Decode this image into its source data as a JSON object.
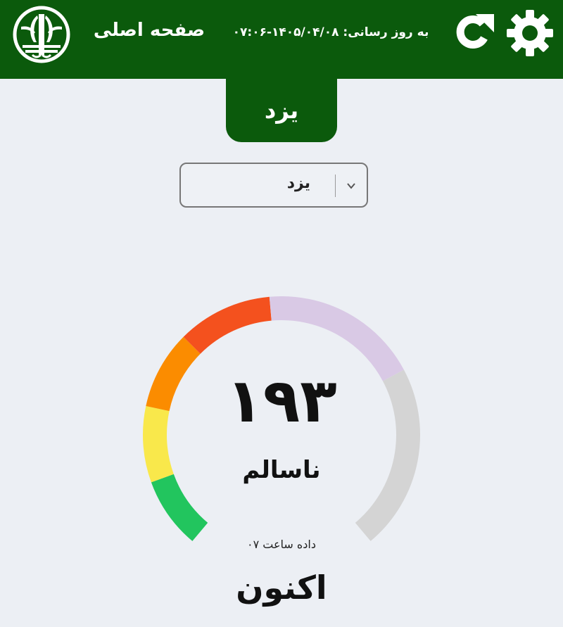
{
  "header": {
    "title": "صفحه اصلی",
    "update_label": "به روز رسانی:",
    "update_value": "۱۴۰۵/۰۴/۰۸-۰۷:۰۶",
    "bg_color": "#0b5a0c",
    "icons": [
      "logo",
      "refresh-icon",
      "gear-icon"
    ]
  },
  "city_tab": {
    "label": "یزد"
  },
  "city_select": {
    "selected": "یزد",
    "icon": "chevron-down-icon"
  },
  "aqi": {
    "value_display": "۱۹۳",
    "value": 193,
    "status": "ناسالم",
    "data_hour": "داده ساعت ۰۷",
    "now_label": "اکنون",
    "gauge_max": 500,
    "segment_colors": [
      "#22c55e",
      "#f9e84b",
      "#fb8c00",
      "#f4511e"
    ],
    "track_colors": [
      "#d9c9e5",
      "#d4d4d4"
    ]
  }
}
